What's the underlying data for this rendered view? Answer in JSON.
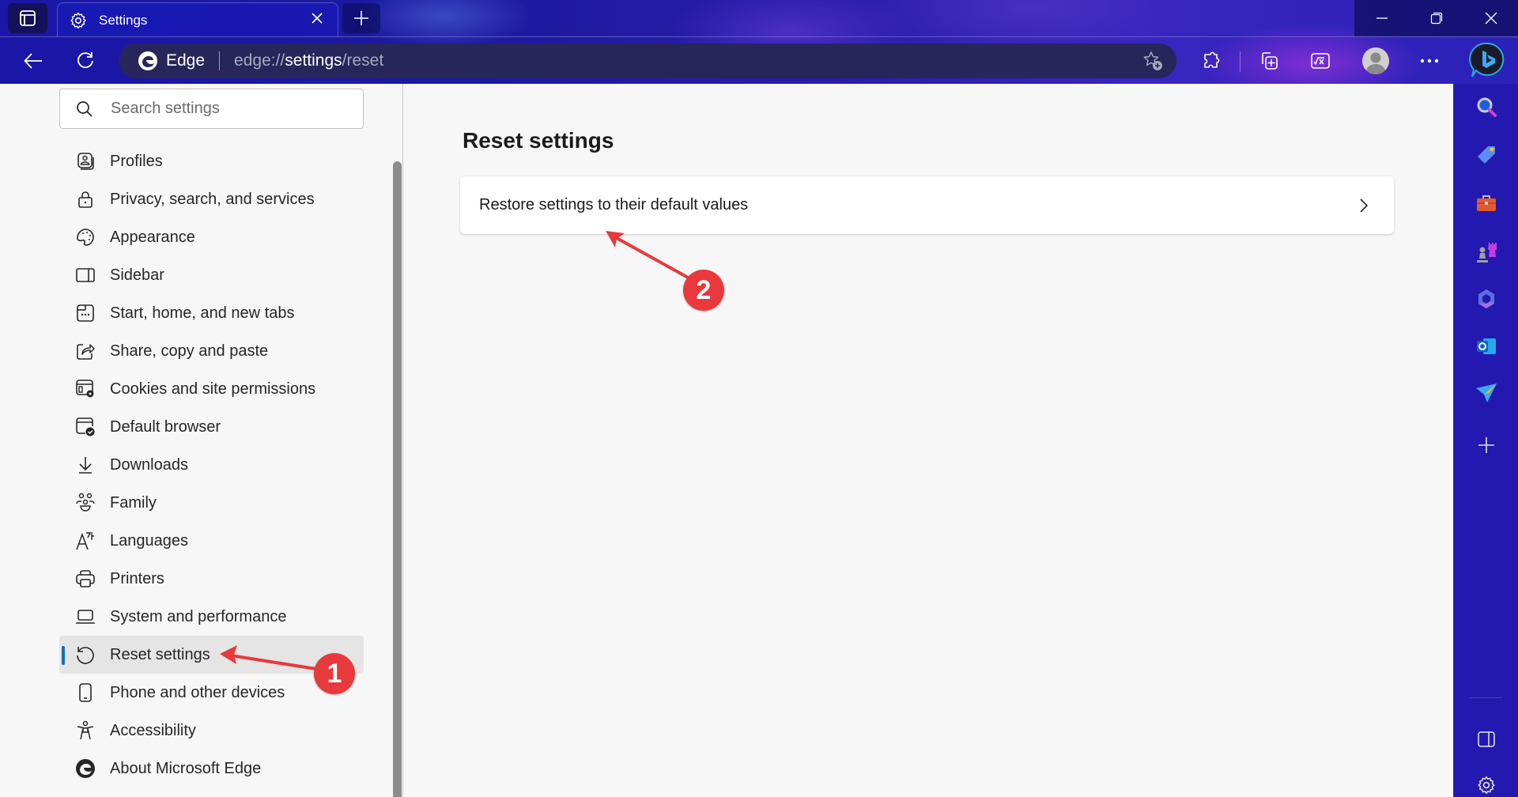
{
  "window": {
    "tab": {
      "title": "Settings",
      "icon": "gear-icon"
    },
    "new_tab_symbol": "+",
    "controls": {
      "minimize": "minimize-icon",
      "restore": "restore-icon",
      "close": "close-icon"
    }
  },
  "toolbar": {
    "site_name": "Edge",
    "url_prefix": "edge://",
    "url_bold": "settings",
    "url_suffix": "/reset",
    "buttons": [
      "back",
      "refresh",
      "favorites-add",
      "extensions",
      "collections",
      "math-solver",
      "profile",
      "more",
      "copilot"
    ]
  },
  "sidebar": {
    "search_placeholder": "Search settings",
    "items": [
      {
        "label": "Profiles",
        "icon": "profiles-icon"
      },
      {
        "label": "Privacy, search, and services",
        "icon": "lock-icon"
      },
      {
        "label": "Appearance",
        "icon": "palette-icon"
      },
      {
        "label": "Sidebar",
        "icon": "sidebar-icon"
      },
      {
        "label": "Start, home, and new tabs",
        "icon": "home-tabs-icon"
      },
      {
        "label": "Share, copy and paste",
        "icon": "share-icon"
      },
      {
        "label": "Cookies and site permissions",
        "icon": "cookies-icon"
      },
      {
        "label": "Default browser",
        "icon": "default-browser-icon"
      },
      {
        "label": "Downloads",
        "icon": "download-icon"
      },
      {
        "label": "Family",
        "icon": "family-icon"
      },
      {
        "label": "Languages",
        "icon": "languages-icon"
      },
      {
        "label": "Printers",
        "icon": "printer-icon"
      },
      {
        "label": "System and performance",
        "icon": "laptop-icon"
      },
      {
        "label": "Reset settings",
        "icon": "reset-icon",
        "active": true
      },
      {
        "label": "Phone and other devices",
        "icon": "phone-icon"
      },
      {
        "label": "Accessibility",
        "icon": "accessibility-icon"
      },
      {
        "label": "About Microsoft Edge",
        "icon": "edge-logo-icon"
      }
    ]
  },
  "main": {
    "title": "Reset settings",
    "card_label": "Restore settings to their default values"
  },
  "edge_sidebar": {
    "items": [
      "search",
      "shopping",
      "tools",
      "games",
      "microsoft-365",
      "outlook",
      "drop",
      "add"
    ],
    "bottom": [
      "hide-sidebar",
      "sidebar-settings"
    ]
  },
  "annotations": [
    {
      "number": "1",
      "target": "Reset settings"
    },
    {
      "number": "2",
      "target": "Restore settings to their default values"
    }
  ],
  "colors": {
    "accent": "#0f6cbd",
    "annotation": "#e8393d",
    "sidebar_bg": "#2318b0"
  }
}
